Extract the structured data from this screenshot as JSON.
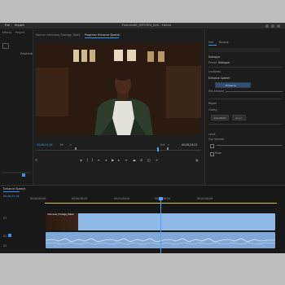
{
  "window": {
    "title": "FeaturettE_IMPORTA_Edit - Edited",
    "menus": [
      "File",
      "Import"
    ]
  },
  "left_panel": {
    "tabs": [
      "Effects",
      "Project"
    ],
    "items": [
      "Emphasis"
    ]
  },
  "monitor_tabs": {
    "source": "Source: Interview_Footage_Take2",
    "program": "Program: Enhance Speech"
  },
  "program_monitor": {
    "current_timecode": "00;06;23;19",
    "fit": "Fit",
    "quality": "Full",
    "duration": "00;06;23;01"
  },
  "essential_sound": {
    "tabs": [
      "Edit",
      "Browse"
    ],
    "preset_label": "Preset",
    "preset_value": "Dialogue",
    "clip_type": "Dialogue",
    "section_loudness": "Loudness",
    "enhance_speech_title": "Enhance Speech",
    "enhance_button": "Enhance",
    "mix_amount_label": "Mix Amount",
    "section_repair": "Repair",
    "section_clarity": "Clarity",
    "auto_match": "Auto-Match",
    "reset": "Reset",
    "section_clip_volume": "Clip Volume",
    "level_label": "Level",
    "mute_label": "Mute"
  },
  "timeline": {
    "tab": "Enhance Speech",
    "timecode": "00;06;23;19",
    "ruler": [
      "00;00;00;00",
      "00;00;30;00",
      "00;01;00;00",
      "00;01;30;00",
      "00;02;00;00"
    ],
    "video_clip_label": "Interview_Footage_Take2",
    "tracks": [
      "V1",
      "A1",
      "A2"
    ]
  },
  "colors": {
    "accent": "#3b8ff0",
    "clip_video": "#8fb8e6",
    "clip_audio": "#7fa8d6",
    "playhead": "#5aa0f0",
    "work_area": "#d9c336"
  }
}
